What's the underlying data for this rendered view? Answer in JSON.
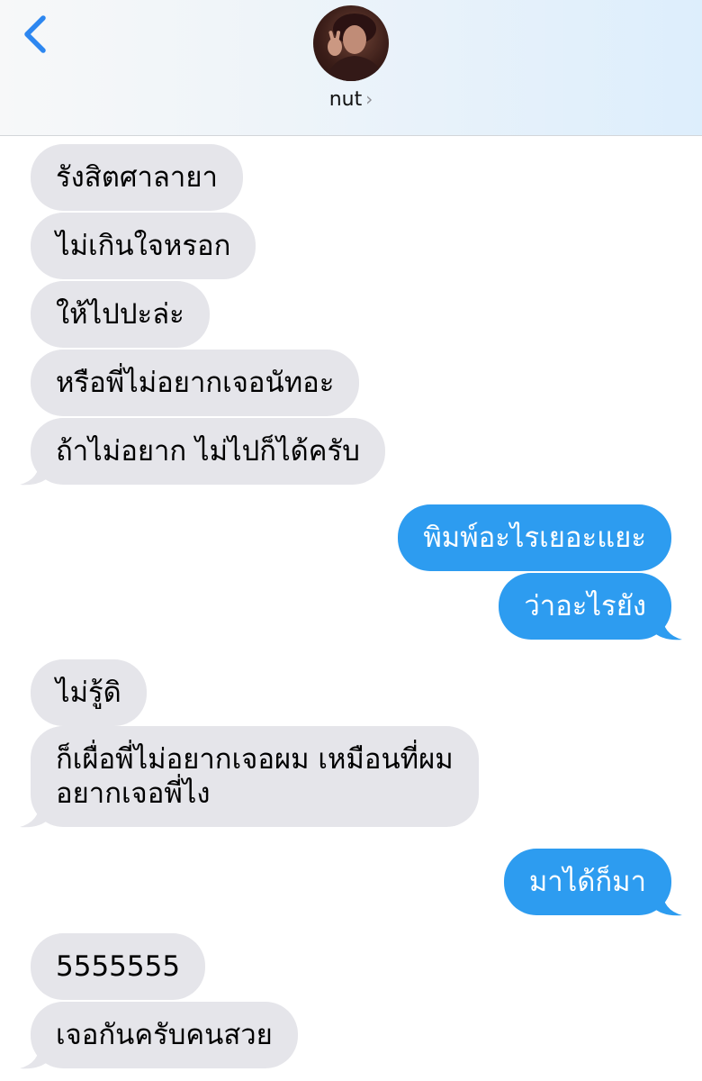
{
  "header": {
    "contact_name": "nut",
    "contact_chevron": "›",
    "back_icon": "chevron-left-icon",
    "accent_color": "#2d9cf0"
  },
  "messages": [
    {
      "direction": "incoming",
      "text": "รังสิตศาลายา"
    },
    {
      "direction": "incoming",
      "text": "ไม่เกินใจหรอก"
    },
    {
      "direction": "incoming",
      "text": "ให้ไปปะล่ะ"
    },
    {
      "direction": "incoming",
      "text": "หรือพี่ไม่อยากเจอนัทอะ"
    },
    {
      "direction": "incoming",
      "text": "ถ้าไม่อยาก ไม่ไปก็ได้ครับ"
    },
    {
      "direction": "outgoing",
      "text": "พิมพ์อะไรเยอะแยะ"
    },
    {
      "direction": "outgoing",
      "text": "ว่าอะไรยัง"
    },
    {
      "direction": "incoming",
      "text": "ไม่รู้ดิ"
    },
    {
      "direction": "incoming",
      "text": "ก็เผื่อพี่ไม่อยากเจอผม เหมือนที่ผม"
    },
    {
      "direction": "incoming",
      "text": "อยากเจอพี่ไง"
    },
    {
      "direction": "outgoing",
      "text": "มาได้ก็มา"
    },
    {
      "direction": "incoming",
      "text": "5555555"
    },
    {
      "direction": "incoming",
      "text": "เจอกันครับคนสวย"
    }
  ]
}
